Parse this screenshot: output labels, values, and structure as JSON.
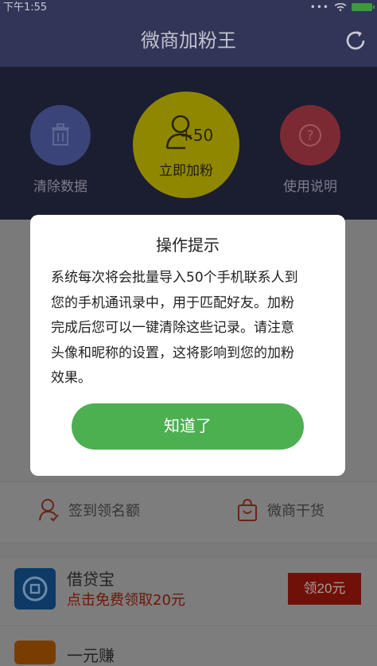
{
  "status_bar": {
    "time": "下午1:55"
  },
  "header": {
    "title": "微商加粉王"
  },
  "actions": {
    "clear_label": "清除数据",
    "add_label": "立即加粉",
    "add_badge": "+50",
    "help_label": "使用说明"
  },
  "features": {
    "signin_label": "签到领名额",
    "goods_label": "微商干货"
  },
  "promos": [
    {
      "title": "借贷宝",
      "subtitle": "点击免费领取20元",
      "button": "领20元"
    },
    {
      "title": "一元赚"
    }
  ],
  "dialog": {
    "title": "操作提示",
    "lines": [
      "系统每次将会批量导入50个手机联系人到",
      "您的手机通讯录中，用于匹配好友。加粉",
      "完成后您可以一键清除这些记录。请注意",
      "头像和昵称的设置，这将影响到您的加粉",
      "效果。"
    ],
    "confirm": "知道了"
  },
  "colors": {
    "header": "#313558",
    "panel": "#1b1d30",
    "confirm_button": "#4caf50",
    "promo_button": "#6f1109"
  }
}
